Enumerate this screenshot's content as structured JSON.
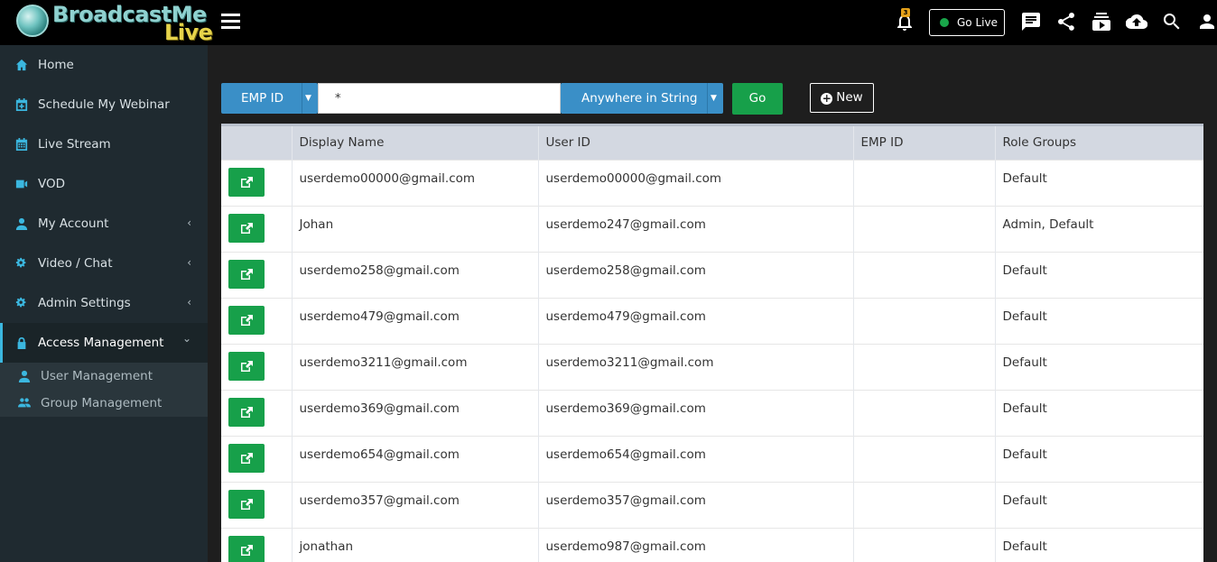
{
  "brand": {
    "name_part1": "BroadcastMe",
    "name_part2": "Live"
  },
  "topbar": {
    "notification_count": "3",
    "go_live_label": "Go Live",
    "icons": [
      "menu-icon",
      "bell-icon",
      "chat-icon",
      "share-icon",
      "playlist-icon",
      "cloud-upload-icon",
      "search-icon",
      "user-icon"
    ]
  },
  "sidebar": {
    "items": [
      {
        "label": "Home",
        "icon": "home-icon",
        "has_chevron": false
      },
      {
        "label": "Schedule My Webinar",
        "icon": "calendar-plus-icon",
        "has_chevron": false
      },
      {
        "label": "Live Stream",
        "icon": "calendar-icon",
        "has_chevron": false
      },
      {
        "label": "VOD",
        "icon": "video-camera-icon",
        "has_chevron": false
      },
      {
        "label": "My Account",
        "icon": "user-icon",
        "has_chevron": true,
        "chevron": "‹"
      },
      {
        "label": "Video / Chat",
        "icon": "cogs-icon",
        "has_chevron": true,
        "chevron": "‹"
      },
      {
        "label": "Admin Settings",
        "icon": "cogs-icon",
        "has_chevron": true,
        "chevron": "‹"
      },
      {
        "label": "Access Management",
        "icon": "lock-icon",
        "has_chevron": true,
        "chevron": "⌄",
        "active": true
      }
    ],
    "subitems": [
      {
        "label": "User Management",
        "icon": "user-icon"
      },
      {
        "label": "Group Management",
        "icon": "users-icon"
      }
    ]
  },
  "search": {
    "field_select": "EMP ID",
    "query_value": "*",
    "match_select": "Anywhere in String",
    "go_label": "Go",
    "new_label": "New"
  },
  "table": {
    "headers": [
      "",
      "Display Name",
      "User ID",
      "EMP ID",
      "Role Groups"
    ],
    "rows": [
      {
        "display_name": "userdemo00000@gmail.com",
        "user_id": "userdemo00000@gmail.com",
        "emp_id": "",
        "role_groups": "Default"
      },
      {
        "display_name": "Johan",
        "user_id": "userdemo247@gmail.com",
        "emp_id": "",
        "role_groups": "Admin, Default"
      },
      {
        "display_name": "userdemo258@gmail.com",
        "user_id": "userdemo258@gmail.com",
        "emp_id": "",
        "role_groups": "Default"
      },
      {
        "display_name": "userdemo479@gmail.com",
        "user_id": "userdemo479@gmail.com",
        "emp_id": "",
        "role_groups": "Default"
      },
      {
        "display_name": "userdemo3211@gmail.com",
        "user_id": "userdemo3211@gmail.com",
        "emp_id": "",
        "role_groups": "Default"
      },
      {
        "display_name": "userdemo369@gmail.com",
        "user_id": "userdemo369@gmail.com",
        "emp_id": "",
        "role_groups": "Default"
      },
      {
        "display_name": "userdemo654@gmail.com",
        "user_id": "userdemo654@gmail.com",
        "emp_id": "",
        "role_groups": "Default"
      },
      {
        "display_name": "userdemo357@gmail.com",
        "user_id": "userdemo357@gmail.com",
        "emp_id": "",
        "role_groups": "Default"
      },
      {
        "display_name": "jonathan",
        "user_id": "userdemo987@gmail.com",
        "emp_id": "",
        "role_groups": "Default"
      }
    ]
  },
  "colors": {
    "accent_blue": "#3a8fc7",
    "action_green": "#17a04a",
    "sidebar_icon": "#3bb7df",
    "badge_orange": "#e6a21a"
  }
}
